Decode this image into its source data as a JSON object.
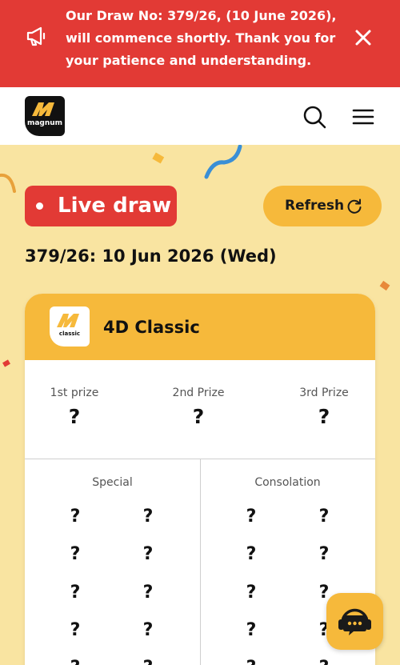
{
  "banner": {
    "message": "Our Draw No: 379/26, (10 June 2026),\nwill commence shortly. Thank you for\nyour patience and understanding.",
    "megaphone_icon": "megaphone-icon",
    "close_icon": "close-icon"
  },
  "header": {
    "logo_text": "magnum",
    "search_icon": "search-icon",
    "menu_icon": "hamburger-menu-icon"
  },
  "live": {
    "label": "Live draw"
  },
  "refresh": {
    "label": "Refresh",
    "icon": "refresh-icon"
  },
  "draw": {
    "title": "379/26: 10 Jun 2026 (Wed)"
  },
  "card": {
    "logo_text": "classic",
    "title": "4D Classic",
    "top_prizes": [
      {
        "label": "1st prize",
        "value": "?"
      },
      {
        "label": "2nd Prize",
        "value": "?"
      },
      {
        "label": "3rd Prize",
        "value": "?"
      }
    ],
    "special": {
      "title": "Special",
      "values": [
        "?",
        "?",
        "?",
        "?",
        "?",
        "?",
        "?",
        "?",
        "?",
        "?"
      ]
    },
    "consolation": {
      "title": "Consolation",
      "values": [
        "?",
        "?",
        "?",
        "?",
        "?",
        "?",
        "?",
        "?",
        "?",
        "?"
      ]
    }
  },
  "chat": {
    "icon": "chat-support-icon"
  },
  "colors": {
    "red": "#e23a35",
    "yellow": "#f6b93b",
    "background": "#f9e4a1"
  }
}
